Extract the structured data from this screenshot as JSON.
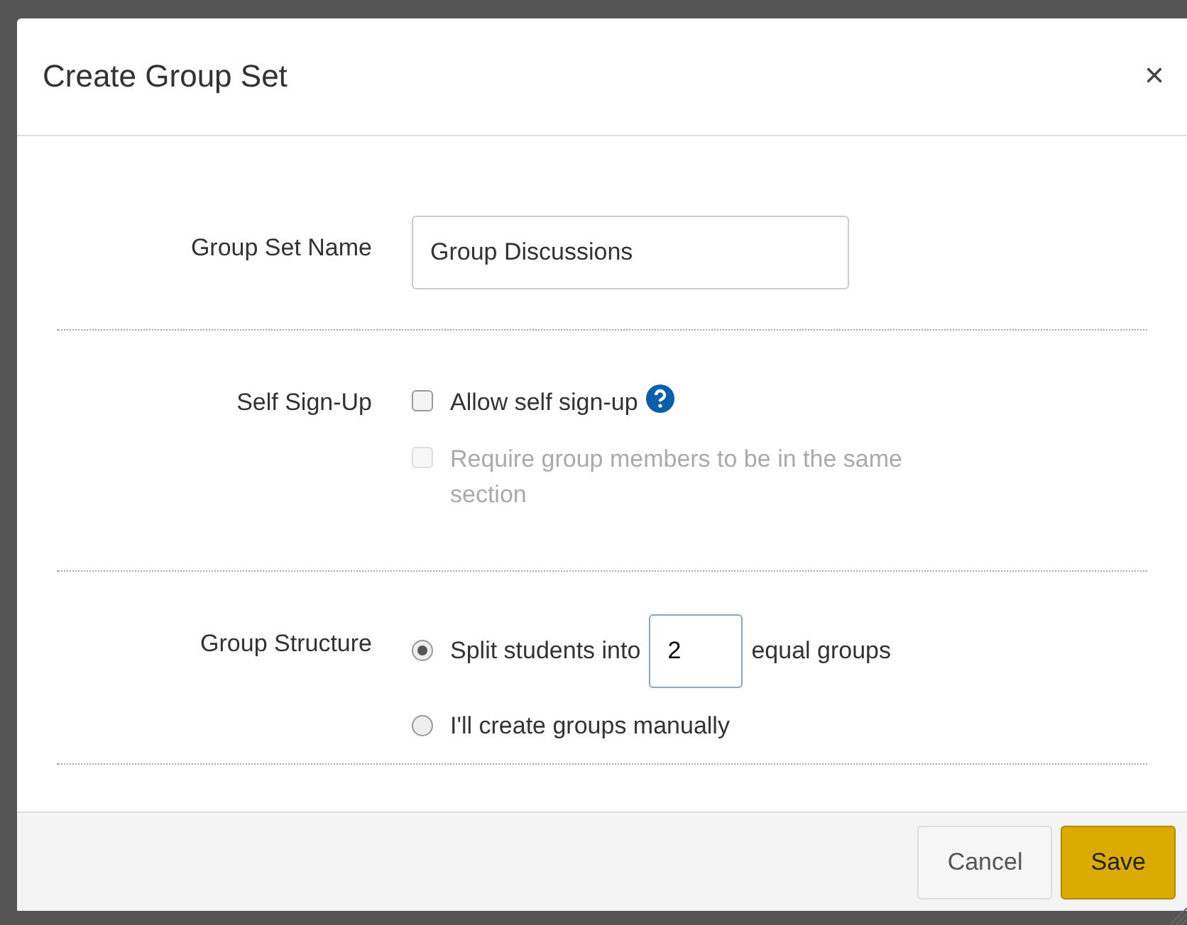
{
  "dialog": {
    "title": "Create Group Set",
    "close": "×"
  },
  "name_row": {
    "label": "Group Set Name",
    "value": "Group Discussions"
  },
  "self_signup": {
    "label": "Self Sign-Up",
    "options": [
      {
        "kind": "checkbox",
        "label": "Allow self sign-up",
        "checked": false,
        "disabled": false,
        "help": true
      },
      {
        "kind": "checkbox",
        "label": "Require group members to be in the same section",
        "checked": false,
        "disabled": true,
        "help": false
      }
    ]
  },
  "structure": {
    "label": "Group Structure",
    "options": [
      {
        "kind": "split",
        "before": "Split students into",
        "value": "2",
        "after": "equal groups",
        "selected": true
      },
      {
        "kind": "plain",
        "label": "I'll create groups manually",
        "selected": false
      }
    ]
  },
  "buttons": [
    {
      "label": "Cancel",
      "kind": "secondary"
    },
    {
      "label": "Save",
      "kind": "primary"
    }
  ]
}
